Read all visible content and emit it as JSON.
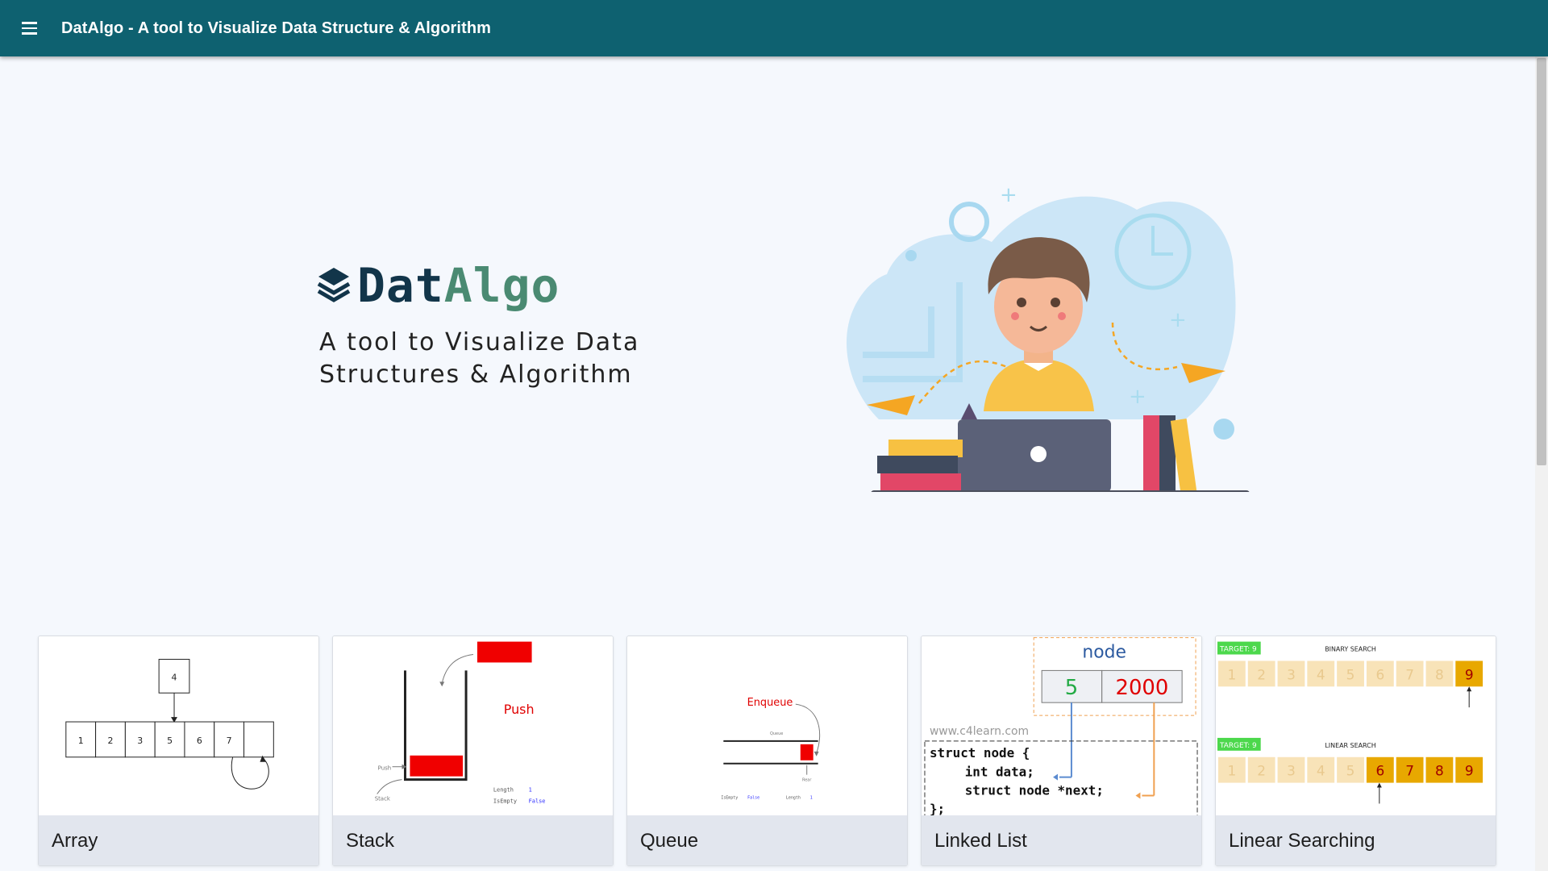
{
  "appbar": {
    "menu_icon": "menu-icon",
    "title": "DatAlgo - A tool to Visualize Data Structure & Algorithm"
  },
  "hero": {
    "logo_icon": "layers-icon",
    "brand_part1": "Dat",
    "brand_part2": "Algo",
    "tagline_line1": "A tool to Visualize Data",
    "tagline_line2": "Structures & Algorithm",
    "illustration": "student-with-laptop-illustration"
  },
  "cards": [
    {
      "title": "Array"
    },
    {
      "title": "Stack"
    },
    {
      "title": "Queue"
    },
    {
      "title": "Linked List"
    },
    {
      "title": "Linear Searching"
    }
  ],
  "previews": {
    "array": {
      "pointer_value": "4",
      "cells": [
        "1",
        "2",
        "3",
        "5",
        "6",
        "7",
        ""
      ]
    },
    "stack": {
      "push_label": "Push",
      "push_pointer": "Push",
      "base_label": "Stack",
      "length_key": "Length",
      "length_val": "1",
      "empty_key": "IsEmpty",
      "empty_val": "False"
    },
    "queue": {
      "enqueue_label": "Enqueue",
      "queue_label": "Queue",
      "rear_label": "Rear",
      "empty_key": "IsEmpty",
      "empty_val": "False",
      "length_key": "Length",
      "length_val": "1"
    },
    "linked_list": {
      "node_label": "node",
      "data_value": "5",
      "next_value": "2000",
      "watermark": "www.c4learn.com",
      "code_line1": "struct node {",
      "code_line2": "int data;",
      "code_line3": "struct node *next;",
      "code_line4": "};"
    },
    "searching": {
      "target_label": "TARGET: 9",
      "binary_title": "BINARY SEARCH",
      "linear_title": "LINEAR SEARCH",
      "numbers": [
        "1",
        "2",
        "3",
        "4",
        "5",
        "6",
        "7",
        "8",
        "9"
      ]
    }
  },
  "colors": {
    "appbar": "#0e6170",
    "brand_dark": "#12354a",
    "brand_green": "#4a8a72",
    "push_red": "#e00000",
    "search_highlight": "#e8a800"
  }
}
